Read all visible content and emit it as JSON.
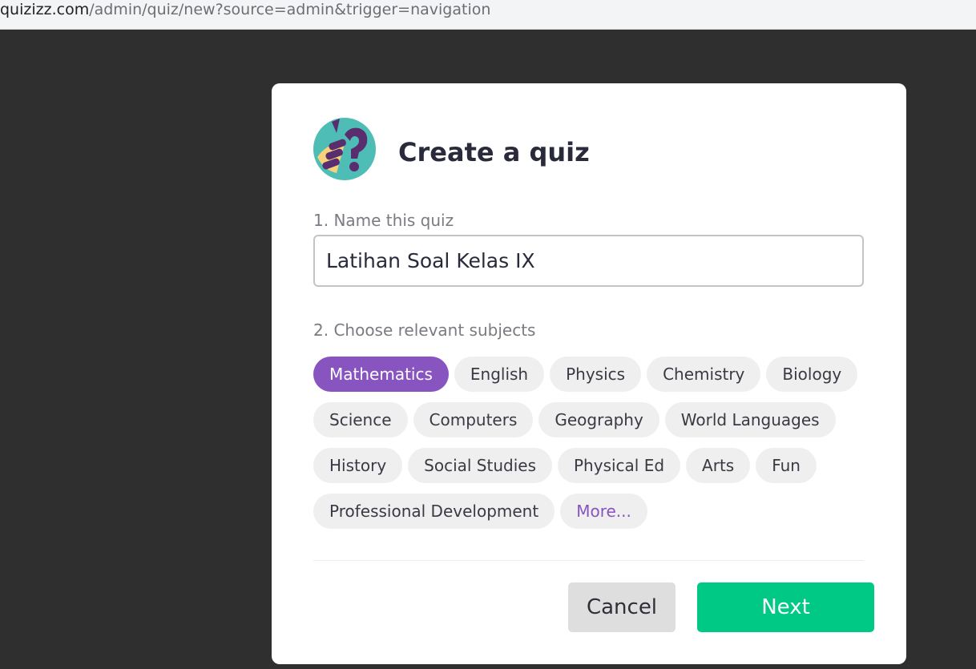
{
  "browser": {
    "url_host": "quizizz.com",
    "url_path": "/admin/quiz/new?source=admin&trigger=navigation"
  },
  "modal": {
    "title": "Create a quiz",
    "logo_icon": "quiz-logo-icon",
    "step1_label": "1. Name this quiz",
    "quiz_name_value": "Latihan Soal Kelas IX",
    "step2_label": "2. Choose relevant subjects",
    "subjects": [
      [
        "Mathematics",
        "English",
        "Physics",
        "Chemistry",
        "Biology"
      ],
      [
        "Science",
        "Computers",
        "Geography",
        "World Languages"
      ],
      [
        "History",
        "Social Studies",
        "Physical Ed",
        "Arts",
        "Fun"
      ],
      [
        "Professional Development"
      ]
    ],
    "selected_subject": "Mathematics",
    "more_label": "More...",
    "cancel_label": "Cancel",
    "next_label": "Next"
  },
  "colors": {
    "accent_purple": "#8854c0",
    "next_green": "#00c985",
    "overlay": "#2f2f2f"
  }
}
